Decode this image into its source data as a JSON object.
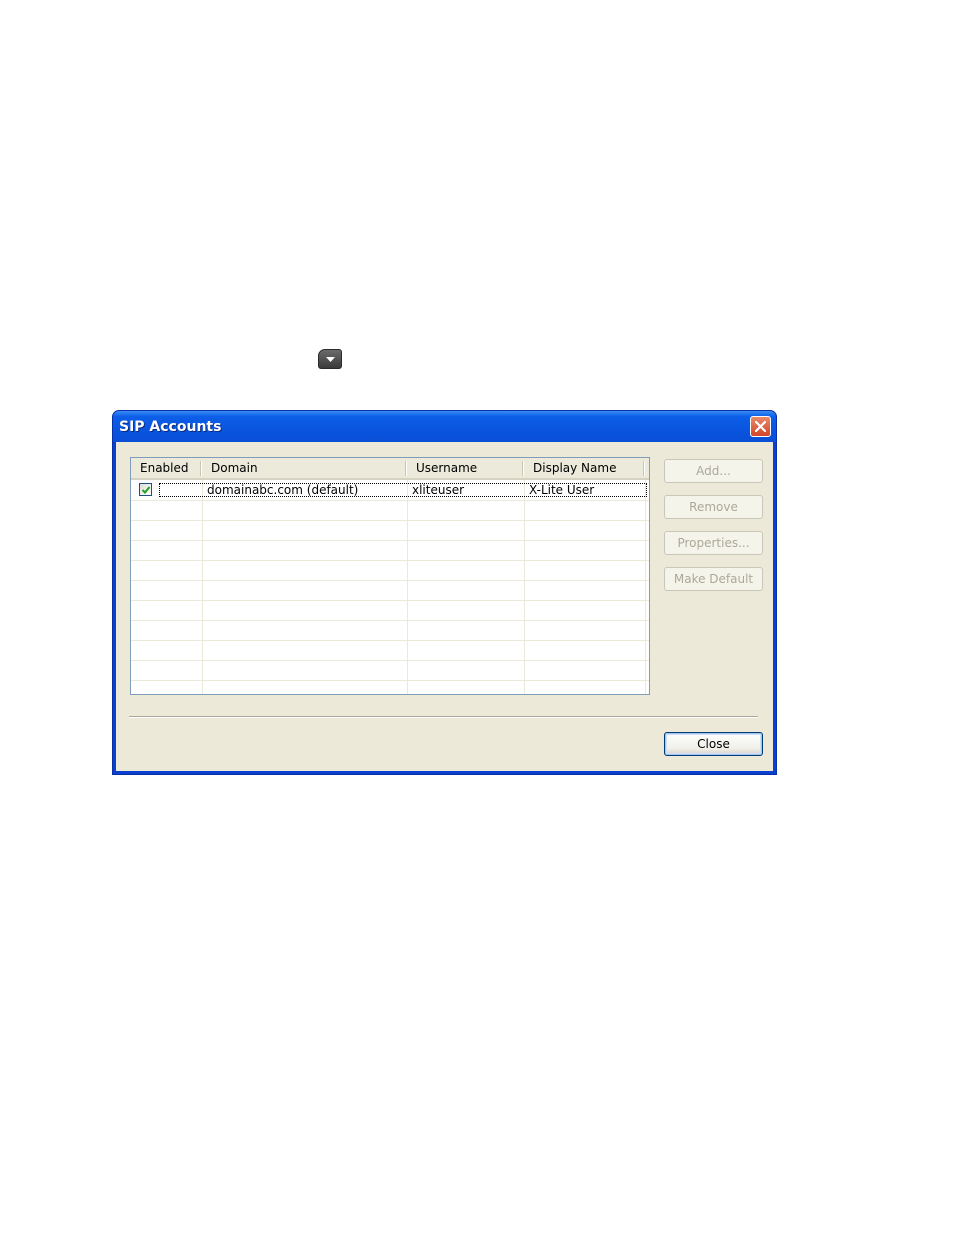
{
  "dialog": {
    "title": "SIP Accounts",
    "close_icon": "close-icon"
  },
  "table": {
    "columns": [
      "Enabled",
      "Domain",
      "Username",
      "Display Name"
    ],
    "rows": [
      {
        "enabled": true,
        "domain": "domainabc.com (default)",
        "username": "xliteuser",
        "display_name": "X-Lite User"
      }
    ]
  },
  "buttons": {
    "add": "Add...",
    "remove": "Remove",
    "properties": "Properties...",
    "make_default": "Make Default",
    "close": "Close"
  },
  "colors": {
    "titlebar": "#0a55df",
    "dialog_face": "#ece9d8",
    "disabled_text": "#aca899"
  }
}
